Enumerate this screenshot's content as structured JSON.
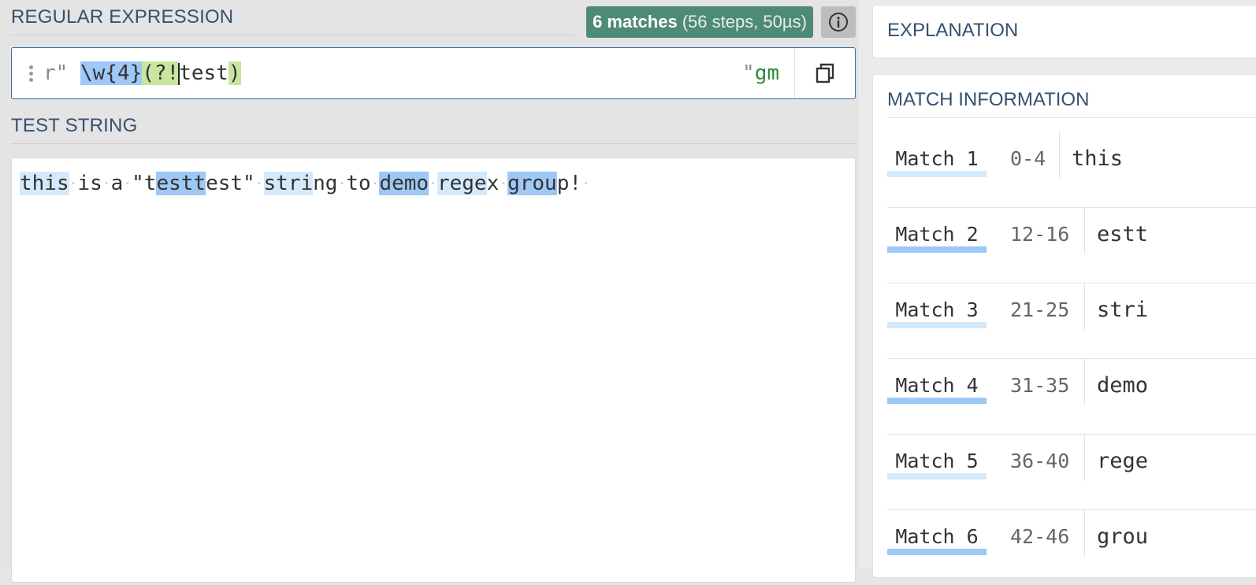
{
  "regex_section": {
    "title": "REGULAR EXPRESSION"
  },
  "badge": {
    "matches": "6 matches",
    "details": "(56 steps, 50µs)"
  },
  "regex": {
    "open_delim": "r\"",
    "tokens": [
      "\\w{4}",
      "(?!",
      "test",
      ")"
    ],
    "close_delim": "\"",
    "flags": "gm"
  },
  "test_section": {
    "title": "TEST STRING"
  },
  "test_string": "this is a \"testtest\" string to demo regex group!",
  "explanation": {
    "title": "EXPLANATION"
  },
  "match_info": {
    "title": "MATCH INFORMATION",
    "rows": [
      {
        "label": "Match 1",
        "range": "0-4",
        "value": "this"
      },
      {
        "label": "Match 2",
        "range": "12-16",
        "value": "estt"
      },
      {
        "label": "Match 3",
        "range": "21-25",
        "value": "stri"
      },
      {
        "label": "Match 4",
        "range": "31-35",
        "value": "demo"
      },
      {
        "label": "Match 5",
        "range": "36-40",
        "value": "rege"
      },
      {
        "label": "Match 6",
        "range": "42-46",
        "value": "grou"
      }
    ]
  },
  "colors": {
    "match_light": "#d4e9fb",
    "match_dark": "#9ec8f5",
    "group": "#c8e6a0",
    "badge": "#4f8a76"
  },
  "icons": {
    "info": "info-circle-icon",
    "copy": "copy-icon",
    "drag": "drag-handle-icon"
  }
}
